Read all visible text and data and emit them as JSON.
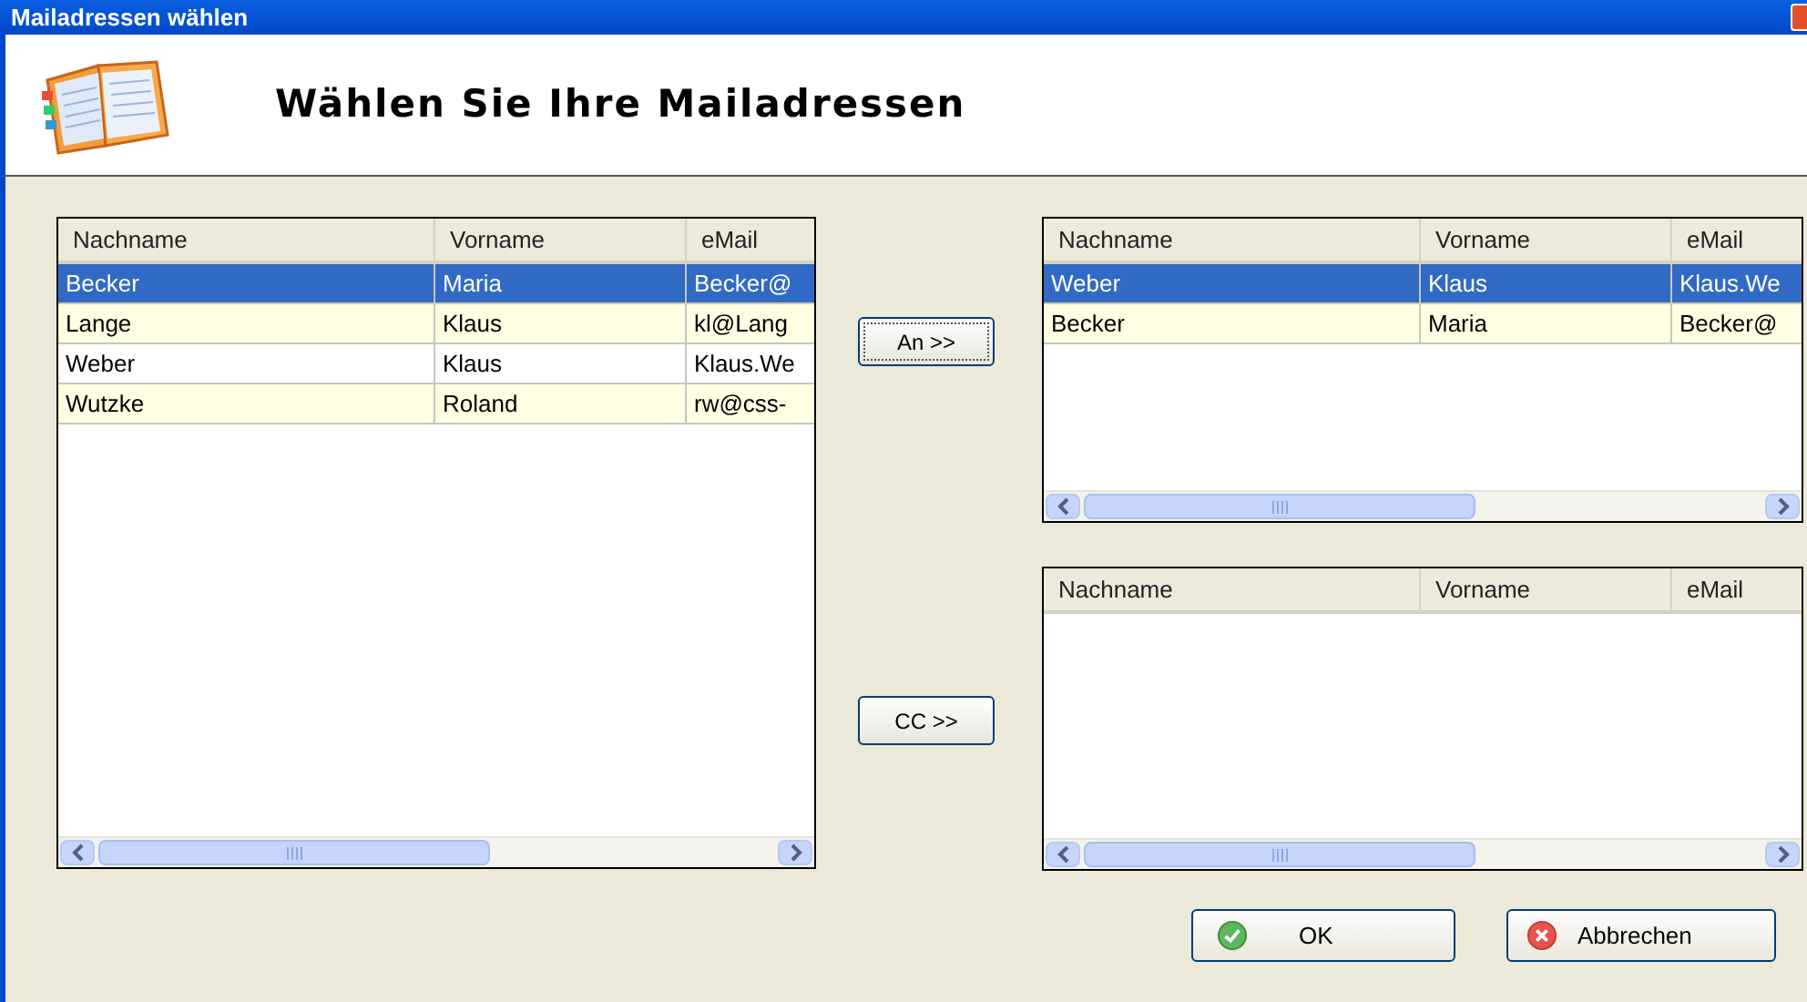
{
  "window": {
    "title": "Mailadressen wählen"
  },
  "header": {
    "title": "Wählen Sie Ihre Mailadressen"
  },
  "source_list": {
    "columns": [
      "Nachname",
      "Vorname",
      "eMail"
    ],
    "rows": [
      {
        "cells": [
          "Becker",
          "Maria",
          "Becker@"
        ],
        "selected": true
      },
      {
        "cells": [
          "Lange",
          "Klaus",
          "kl@Lang"
        ],
        "selected": false
      },
      {
        "cells": [
          "Weber",
          "Klaus",
          "Klaus.We"
        ],
        "selected": false
      },
      {
        "cells": [
          "Wutzke",
          "Roland",
          "rw@css-"
        ],
        "selected": false
      }
    ]
  },
  "move_buttons": [
    "An >>",
    "CC >>"
  ],
  "to_list": {
    "columns": [
      "Nachname",
      "Vorname",
      "eMail"
    ],
    "rows": [
      {
        "cells": [
          "Weber",
          "Klaus",
          "Klaus.We"
        ],
        "selected": true
      },
      {
        "cells": [
          "Becker",
          "Maria",
          "Becker@"
        ],
        "selected": false
      }
    ]
  },
  "cc_list": {
    "columns": [
      "Nachname",
      "Vorname",
      "eMail"
    ]
  },
  "buttons": [
    {
      "kind": "ok",
      "label": "OK"
    },
    {
      "kind": "cancel",
      "label": "Abbrechen"
    }
  ]
}
